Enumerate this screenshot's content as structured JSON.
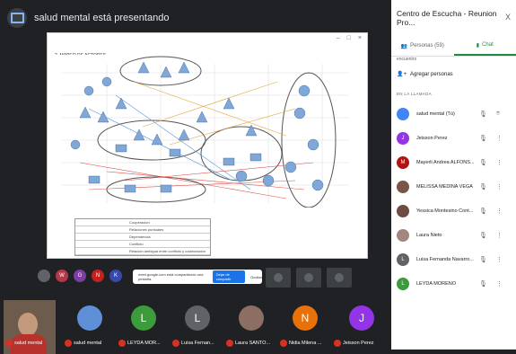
{
  "presentation": {
    "title": "salud mental está presentando"
  },
  "slide": {
    "heading": "2. MAPEO DE ACTORES",
    "legend": [
      "Cooperación",
      "Relaciones puntuales",
      "Dependencia",
      "Conflicto",
      "Relación ambigua entre conflicto y colaboración"
    ]
  },
  "share_banner": {
    "text": "meet.google.com está compartiendo una pestaña.",
    "stop_label": "Dejar de compartir",
    "hide_label": "Ocultar"
  },
  "thumbs": [
    {
      "letter": "",
      "color": "#5f6368"
    },
    {
      "letter": "W",
      "color": "#b23a48"
    },
    {
      "letter": "G",
      "color": "#7b3fa0"
    },
    {
      "letter": "N",
      "color": "#c5221f"
    },
    {
      "letter": "K",
      "color": "#3949ab"
    }
  ],
  "bottom_tiles": [
    {
      "name": "salud mental",
      "letter": "",
      "color": "#4285f4"
    },
    {
      "name": "salud mental",
      "letter": "",
      "color": "#5f8fd6"
    },
    {
      "name": "LEYDA MOR...",
      "letter": "L",
      "color": "#3c9c3c"
    },
    {
      "name": "Luisa Fernan...",
      "letter": "L",
      "color": "#5f6368"
    },
    {
      "name": "Laura SANTO...",
      "letter": "",
      "color": "#8d6e63"
    },
    {
      "name": "Nidia Milena ...",
      "letter": "N",
      "color": "#e8710a"
    },
    {
      "name": "Jeisson Perez",
      "letter": "J",
      "color": "#9334e6"
    }
  ],
  "panel": {
    "title": "Centro de Escucha - Reunion Pro...",
    "close": "X",
    "tab_people": "Personas (59)",
    "tab_chat": "Chat",
    "encuentro": "encuentro",
    "add_people": "Agregar personas",
    "section": "EN LA LLAMADA",
    "people": [
      {
        "name": "salud mental (Tú)",
        "letter": "",
        "color": "#4285f4"
      },
      {
        "name": "Jeisson Perez",
        "letter": "J",
        "color": "#9334e6"
      },
      {
        "name": "Mayerli Andrea ALFONS...",
        "letter": "M",
        "color": "#b31412"
      },
      {
        "name": "MELISSA MEDINA VEGA",
        "letter": "",
        "color": "#795548"
      },
      {
        "name": "Yessica Montesino Cont...",
        "letter": "",
        "color": "#6d4c41"
      },
      {
        "name": "Laura Nieto",
        "letter": "",
        "color": "#a1887f"
      },
      {
        "name": "Luisa Fernanda Navarro...",
        "letter": "L",
        "color": "#5f6368"
      },
      {
        "name": "LEYDA MORENO",
        "letter": "L",
        "color": "#3c9c3c"
      }
    ]
  }
}
